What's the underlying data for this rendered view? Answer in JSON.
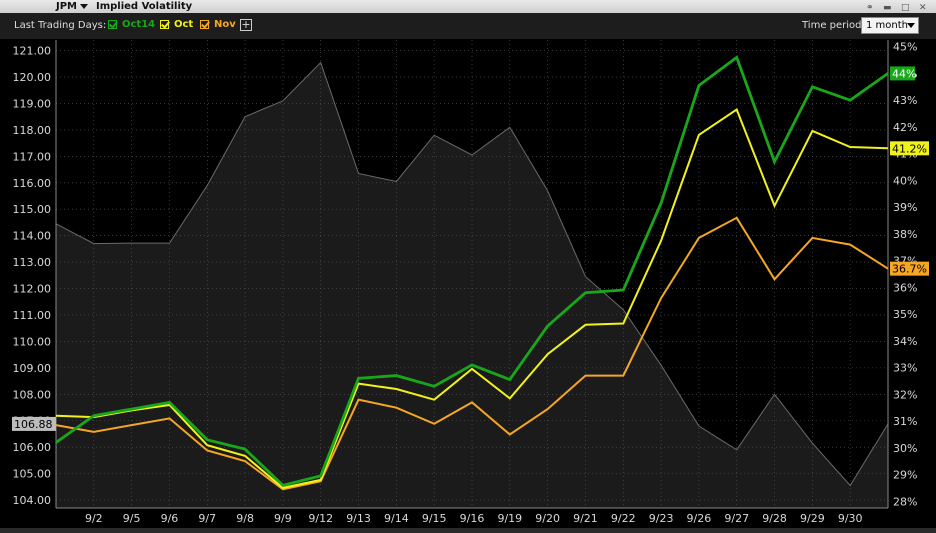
{
  "window": {
    "symbol": "JPM",
    "title": "Implied Volatility"
  },
  "toolbar": {
    "last_trading_days_label": "Last Trading Days:",
    "add_button_label": "+",
    "time_period_label": "Time period:",
    "time_period_value": "1 month"
  },
  "colors": {
    "oct14": "#19a71a",
    "oct": "#f2f21b",
    "nov": "#f5a623",
    "price_area": "#1b1b1b",
    "price_line": "#6a6a6a",
    "grid": "#5a5a5a",
    "background": "#000000"
  },
  "chart_data": {
    "type": "line",
    "categories": [
      "",
      "9/2",
      "9/5",
      "9/6",
      "9/7",
      "9/8",
      "9/9",
      "9/12",
      "9/13",
      "9/14",
      "9/15",
      "9/16",
      "9/19",
      "9/20",
      "9/21",
      "9/22",
      "9/23",
      "9/26",
      "9/27",
      "9/28",
      "9/29",
      "9/30",
      ""
    ],
    "left_axis": {
      "ylim": [
        103.7,
        121.4
      ],
      "ticks": [
        "121.00",
        "120.00",
        "119.00",
        "118.00",
        "117.00",
        "116.00",
        "115.00",
        "114.00",
        "113.00",
        "112.00",
        "111.00",
        "110.00",
        "109.00",
        "108.00",
        "107.00",
        "106.00",
        "105.00",
        "104.00"
      ],
      "current_value_label": "106.88",
      "current_value": 106.88
    },
    "right_axis": {
      "ylim": [
        27.75,
        45.25
      ],
      "ticks": [
        "45%",
        "44%",
        "43%",
        "42%",
        "41%",
        "40%",
        "39%",
        "38%",
        "37%",
        "36%",
        "35%",
        "34%",
        "33%",
        "32%",
        "31%",
        "30%",
        "29%",
        "28%"
      ]
    },
    "grid": true,
    "legend_position": "top-left",
    "price_series": {
      "values": [
        114.45,
        113.7,
        113.72,
        113.72,
        115.9,
        118.5,
        119.1,
        120.55,
        116.35,
        116.05,
        117.8,
        117.05,
        118.1,
        115.7,
        112.45,
        111.2,
        109.1,
        106.8,
        105.9,
        108.0,
        106.15,
        104.55,
        106.88
      ]
    },
    "series": [
      {
        "name": "Oct14",
        "color": "#19a71a",
        "axis": "right",
        "values": [
          30.2,
          31.2,
          31.45,
          31.7,
          30.3,
          29.95,
          28.6,
          28.95,
          32.6,
          32.7,
          32.3,
          33.1,
          32.55,
          34.55,
          35.8,
          35.9,
          39.15,
          43.55,
          44.6,
          40.7,
          43.5,
          43.0,
          44.0
        ],
        "last_label": "44%"
      },
      {
        "name": "Oct",
        "color": "#f2f21b",
        "axis": "right",
        "values": [
          31.2,
          31.15,
          31.4,
          31.6,
          30.1,
          29.7,
          28.5,
          28.8,
          32.4,
          32.2,
          31.8,
          32.95,
          31.85,
          33.5,
          34.6,
          34.65,
          37.75,
          41.7,
          42.65,
          39.05,
          41.85,
          41.25,
          41.2
        ],
        "last_label": "41.2%"
      },
      {
        "name": "Nov",
        "color": "#f5a623",
        "axis": "right",
        "values": [
          30.85,
          30.6,
          30.85,
          31.1,
          29.9,
          29.5,
          28.45,
          28.75,
          31.8,
          31.5,
          30.9,
          31.7,
          30.5,
          31.45,
          32.7,
          32.7,
          35.6,
          37.85,
          38.6,
          36.3,
          37.85,
          37.6,
          36.7
        ],
        "last_label": "36.7%"
      }
    ]
  }
}
